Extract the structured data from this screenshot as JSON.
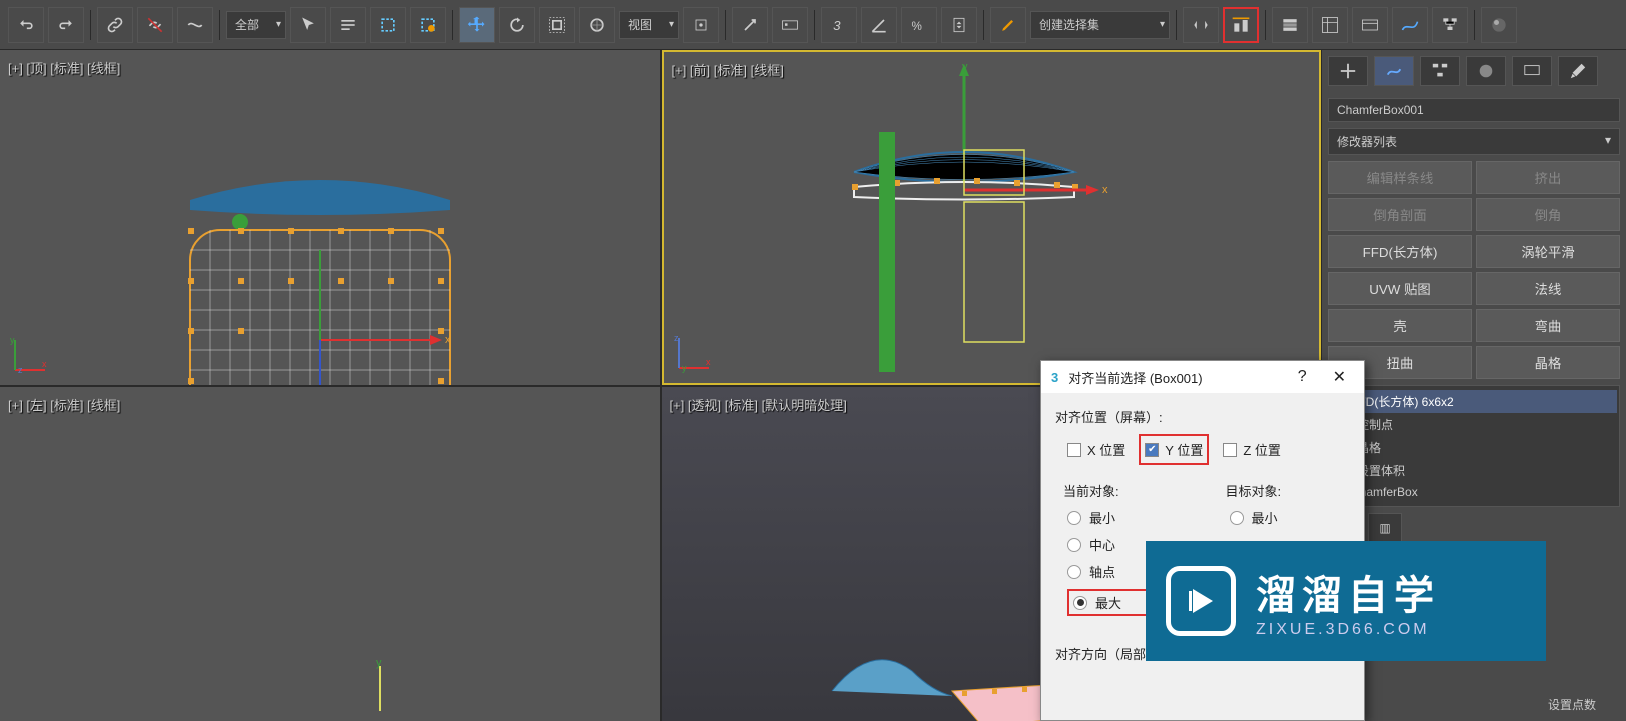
{
  "toolbar": {
    "selection_filter": "全部",
    "ref_coord": "视图",
    "named_set": "创建选择集"
  },
  "viewports": {
    "top": "[+] [顶] [标准] [线框]",
    "front": "[+] [前] [标准] [线框]",
    "left": "[+] [左] [标准] [线框]",
    "persp": "[+] [透视] [标准] [默认明暗处理]"
  },
  "right_panel": {
    "object_name": "ChamferBox001",
    "modifier_list_label": "修改器列表",
    "buttons": [
      "编辑样条线",
      "挤出",
      "倒角剖面",
      "倒角",
      "FFD(长方体)",
      "涡轮平滑",
      "UVW 贴图",
      "法线",
      "壳",
      "弯曲",
      "扭曲",
      "晶格"
    ],
    "stack": {
      "top": "FFD(长方体) 6x6x2",
      "sub1": "控制点",
      "sub2": "晶格",
      "sub3": "设置体积",
      "base": "ChamferBox"
    }
  },
  "dialog": {
    "title": "对齐当前选择 (Box001)",
    "pos_group": "对齐位置（屏幕）:",
    "x": "X 位置",
    "y": "Y 位置",
    "z": "Z 位置",
    "current": "当前对象:",
    "target": "目标对象:",
    "min": "最小",
    "center": "中心",
    "pivot": "轴点",
    "max": "最大",
    "orient_group": "对齐方向（局部"
  },
  "watermark": {
    "big": "溜溜自学",
    "small": "ZIXUE.3D66.COM"
  },
  "footer": "设置点数"
}
